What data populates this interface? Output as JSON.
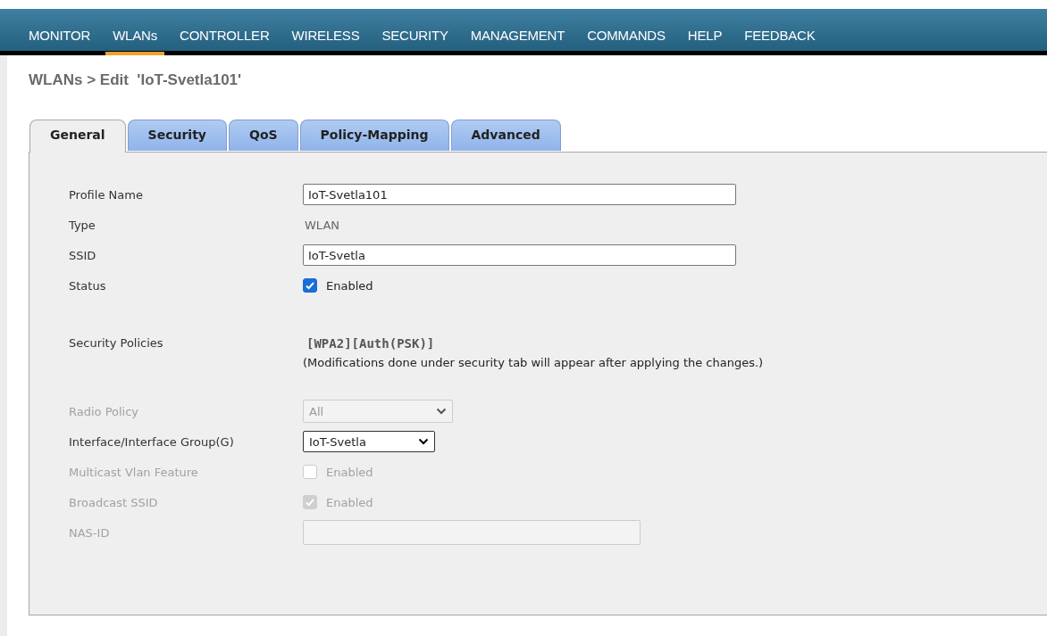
{
  "nav": [
    {
      "label": "MONITOR",
      "selected": false
    },
    {
      "label": "WLANs",
      "selected": true
    },
    {
      "label": "CONTROLLER",
      "selected": false
    },
    {
      "label": "WIRELESS",
      "selected": false
    },
    {
      "label": "SECURITY",
      "selected": false
    },
    {
      "label": "MANAGEMENT",
      "selected": false
    },
    {
      "label": "COMMANDS",
      "selected": false
    },
    {
      "label": "HELP",
      "selected": false
    },
    {
      "label": "FEEDBACK",
      "selected": false
    }
  ],
  "page_title": "WLANs > Edit  'IoT-Svetla101'",
  "tabs": [
    {
      "label": "General",
      "selected": true
    },
    {
      "label": "Security",
      "selected": false
    },
    {
      "label": "QoS",
      "selected": false
    },
    {
      "label": "Policy-Mapping",
      "selected": false
    },
    {
      "label": "Advanced",
      "selected": false
    }
  ],
  "fields": [
    {
      "kind": "input",
      "label": "Profile Name",
      "value": "IoT-Svetla101",
      "disabled": false
    },
    {
      "kind": "text",
      "label": "Type",
      "value": "WLAN"
    },
    {
      "kind": "input",
      "label": "SSID",
      "value": "IoT-Svetla",
      "disabled": false
    },
    {
      "kind": "checkbox",
      "label": "Status",
      "value": "Enabled",
      "checked": true,
      "disabled": false
    },
    {
      "kind": "policy",
      "label": "Security Policies",
      "value": "[WPA2][Auth(PSK)]",
      "note": "(Modifications done under security tab will appear after applying the changes.)"
    },
    {
      "kind": "select",
      "label": "Radio Policy",
      "value": "All",
      "disabled": true
    },
    {
      "kind": "select",
      "label": "Interface/Interface Group(G)",
      "value": "IoT-Svetla",
      "disabled": false
    },
    {
      "kind": "checkbox",
      "label": "Multicast Vlan Feature",
      "value": "Enabled",
      "checked": false,
      "disabled": true
    },
    {
      "kind": "checkbox",
      "label": "Broadcast SSID",
      "value": "Enabled",
      "checked": true,
      "disabled": true
    },
    {
      "kind": "input",
      "label": "NAS-ID",
      "disabled": true
    }
  ]
}
